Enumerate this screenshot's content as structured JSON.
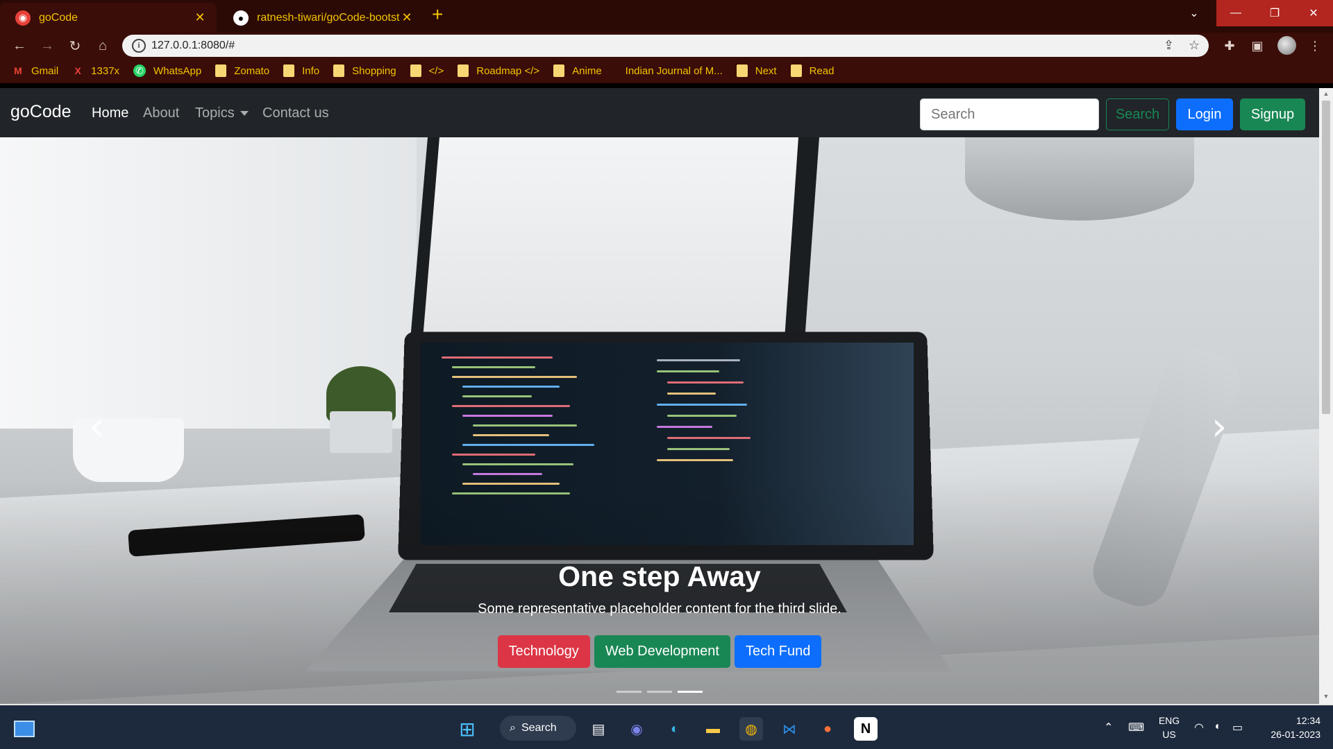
{
  "browser": {
    "tabs": [
      {
        "title": "goCode",
        "active": true
      },
      {
        "title": "ratnesh-tiwari/goCode-bootstrap",
        "active": false
      }
    ],
    "new_tab": "+",
    "url": "127.0.0.1:8080/#",
    "bookmarks": [
      {
        "label": "Gmail",
        "icon": "gmail-icon"
      },
      {
        "label": "1337x",
        "icon": "x-icon"
      },
      {
        "label": "WhatsApp",
        "icon": "whatsapp-icon"
      },
      {
        "label": "Zomato",
        "icon": "folder-icon"
      },
      {
        "label": "Info",
        "icon": "folder-icon"
      },
      {
        "label": "Shopping",
        "icon": "folder-icon"
      },
      {
        "label": "</>",
        "icon": "folder-icon"
      },
      {
        "label": "Roadmap </>",
        "icon": "folder-icon"
      },
      {
        "label": "Anime",
        "icon": "folder-icon"
      },
      {
        "label": "Indian Journal of M...",
        "icon": "none"
      },
      {
        "label": "Next",
        "icon": "folder-icon"
      },
      {
        "label": "Read",
        "icon": "folder-icon"
      }
    ],
    "accent": "#f4c400"
  },
  "site": {
    "brand": "goCode",
    "nav": [
      "Home",
      "About",
      "Topics",
      "Contact us"
    ],
    "search_placeholder": "Search",
    "search_button": "Search",
    "login": "Login",
    "signup": "Signup",
    "carousel": {
      "title": "One step Away",
      "text": "Some representative placeholder content for the third slide.",
      "buttons": [
        "Technology",
        "Web Development",
        "Tech Fund"
      ],
      "active_slide": 3,
      "slide_count": 3
    }
  },
  "taskbar": {
    "search": "Search",
    "lang_top": "ENG",
    "lang_bottom": "US",
    "time": "12:34",
    "date": "26-01-2023"
  }
}
